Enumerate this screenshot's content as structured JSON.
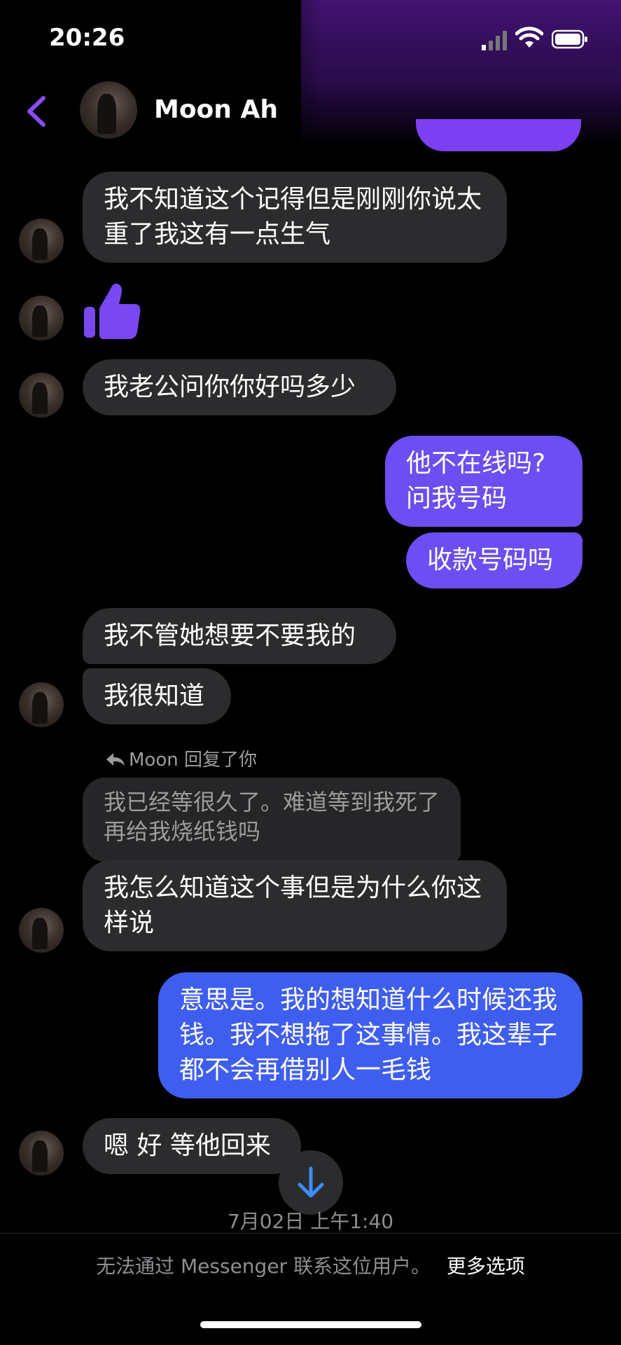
{
  "status_bar": {
    "time": "20:26"
  },
  "header": {
    "contact_name": "Moon Ah"
  },
  "messages": [
    {
      "side": "them",
      "text": "我不知道这个记得但是刚刚你说太重了我这有一点生气"
    },
    {
      "side": "them",
      "type": "like-sticker",
      "icon": "thumbs-up-icon"
    },
    {
      "side": "them",
      "text": "我老公问你你好吗多少"
    },
    {
      "side": "me",
      "text": "他不在线吗?问我号码"
    },
    {
      "side": "me",
      "text": "收款号码吗"
    },
    {
      "side": "them",
      "text": "我不管她想要不要我的"
    },
    {
      "side": "them",
      "text": "我很知道"
    },
    {
      "side": "them",
      "reply_label": "Moon 回复了你",
      "quoted": "我已经等很久了。难道等到我死了再给我烧纸钱吗",
      "text": "我怎么知道这个事但是为什么你这样说"
    },
    {
      "side": "me",
      "text": "意思是。我的想知道什么时候还我钱。我不想拖了这事情。我这辈子都不会再借别人一毛钱"
    },
    {
      "side": "them",
      "text": "嗯 好 等他回来"
    }
  ],
  "timestamp": "7月02日 上午1:40",
  "footer": {
    "notice": "无法通过 Messenger 联系这位用户。",
    "more_options": "更多选项"
  },
  "colors": {
    "accent": "#7d3ff2",
    "my_bubble": "#6c4ef2",
    "my_bubble_blue": "#3f5ef0",
    "their_bubble": "#2c2c2e",
    "background": "#000000"
  }
}
